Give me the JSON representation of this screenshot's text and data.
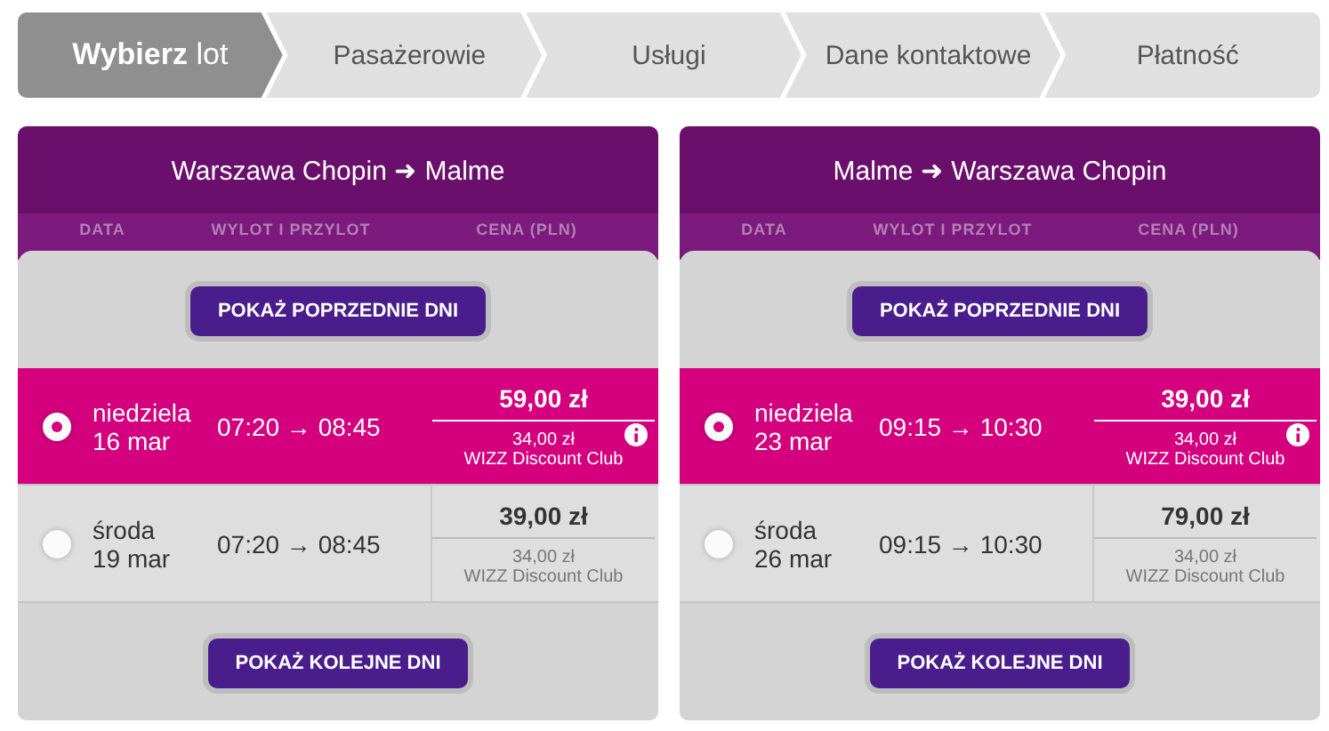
{
  "steps": [
    {
      "label": "**Wybierz** lot",
      "selected": true
    },
    {
      "label": "Pasażerowie",
      "selected": false
    },
    {
      "label": "Usługi",
      "selected": false
    },
    {
      "label": "Dane kontaktowe",
      "selected": false
    },
    {
      "label": "Płatność",
      "selected": false
    }
  ],
  "panels": [
    {
      "route": "Warszawa Chopin ➜ Malme",
      "columns": [
        "DATA",
        "WYLOT I PRZYLOT",
        "CENA (PLN)"
      ],
      "prev_button": "POKAŻ POPRZEDNIE DNI",
      "next_button": "POKAŻ KOLEJNE DNI",
      "flights": [
        {
          "day": "niedziela",
          "date": "16 mar",
          "times": "07:20 → 08:45",
          "price": "59,00 zł",
          "club_price": "34,00 zł",
          "club_label": "WIZZ Discount Club",
          "selected": true
        },
        {
          "day": "środa",
          "date": "19 mar",
          "times": "07:20 → 08:45",
          "price": "39,00 zł",
          "club_price": "34,00 zł",
          "club_label": "WIZZ Discount Club",
          "selected": false
        }
      ]
    },
    {
      "route": "Malme ➜ Warszawa Chopin",
      "columns": [
        "DATA",
        "WYLOT I PRZYLOT",
        "CENA (PLN)"
      ],
      "prev_button": "POKAŻ POPRZEDNIE DNI",
      "next_button": "POKAŻ KOLEJNE DNI",
      "flights": [
        {
          "day": "niedziela",
          "date": "23 mar",
          "times": "09:15 → 10:30",
          "price": "39,00 zł",
          "club_price": "34,00 zł",
          "club_label": "WIZZ Discount Club",
          "selected": true
        },
        {
          "day": "środa",
          "date": "26 mar",
          "times": "09:15 → 10:30",
          "price": "79,00 zł",
          "club_price": "34,00 zł",
          "club_label": "WIZZ Discount Club",
          "selected": false
        }
      ]
    }
  ]
}
